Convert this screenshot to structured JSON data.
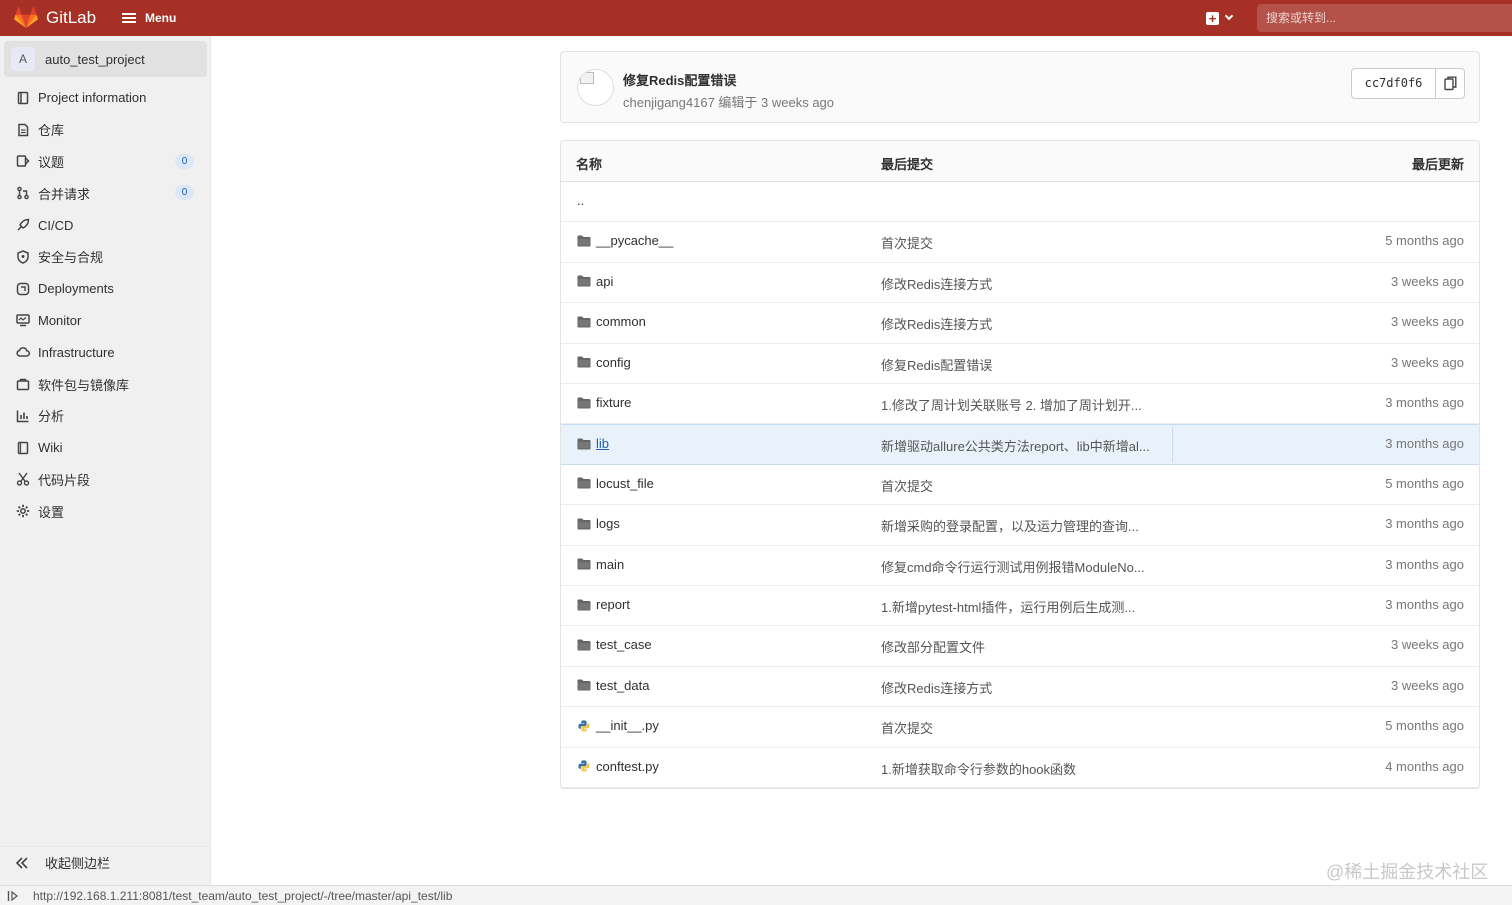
{
  "topbar": {
    "brand": "GitLab",
    "menu_label": "Menu",
    "search_placeholder": "搜索或转到..."
  },
  "sidebar": {
    "project_initial": "A",
    "project_name": "auto_test_project",
    "items": [
      {
        "label": "Project information",
        "icon": "info-book-icon"
      },
      {
        "label": "仓库",
        "icon": "repository-doc-icon"
      },
      {
        "label": "议题",
        "icon": "issues-icon",
        "badge": "0"
      },
      {
        "label": "合并请求",
        "icon": "merge-request-icon",
        "badge": "0"
      },
      {
        "label": "CI/CD",
        "icon": "rocket-icon"
      },
      {
        "label": "安全与合规",
        "icon": "shield-icon"
      },
      {
        "label": "Deployments",
        "icon": "deployments-icon"
      },
      {
        "label": "Monitor",
        "icon": "monitor-icon"
      },
      {
        "label": "Infrastructure",
        "icon": "cloud-icon"
      },
      {
        "label": "软件包与镜像库",
        "icon": "package-icon"
      },
      {
        "label": "分析",
        "icon": "chart-icon"
      },
      {
        "label": "Wiki",
        "icon": "book-icon"
      },
      {
        "label": "代码片段",
        "icon": "scissors-icon"
      },
      {
        "label": "设置",
        "icon": "gear-icon"
      }
    ],
    "collapse_label": "收起侧边栏"
  },
  "commit": {
    "title": "修复Redis配置错误",
    "meta": "chenjigang4167 编辑于 3 weeks ago",
    "sha": "cc7df0f6"
  },
  "tree": {
    "headers": {
      "name": "名称",
      "last_commit": "最后提交",
      "last_update": "最后更新"
    },
    "parent_dir": "..",
    "rows": [
      {
        "name": "__pycache__",
        "type": "folder",
        "commit": "首次提交",
        "date": "5 months ago"
      },
      {
        "name": "api",
        "type": "folder",
        "commit": "修改Redis连接方式",
        "date": "3 weeks ago"
      },
      {
        "name": "common",
        "type": "folder",
        "commit": "修改Redis连接方式",
        "date": "3 weeks ago"
      },
      {
        "name": "config",
        "type": "folder",
        "commit": "修复Redis配置错误",
        "date": "3 weeks ago"
      },
      {
        "name": "fixture",
        "type": "folder",
        "commit": "1.修改了周计划关联账号 2. 增加了周计划开...",
        "date": "3 months ago"
      },
      {
        "name": "lib",
        "type": "folder",
        "commit": "新增驱动allure公共类方法report、lib中新增al...",
        "date": "3 months ago",
        "highlighted": true
      },
      {
        "name": "locust_file",
        "type": "folder",
        "commit": "首次提交",
        "date": "5 months ago"
      },
      {
        "name": "logs",
        "type": "folder",
        "commit": "新增采购的登录配置，以及运力管理的查询...",
        "date": "3 months ago"
      },
      {
        "name": "main",
        "type": "folder",
        "commit": "修复cmd命令行运行测试用例报错ModuleNo...",
        "date": "3 months ago"
      },
      {
        "name": "report",
        "type": "folder",
        "commit": "1.新增pytest-html插件，运行用例后生成测...",
        "date": "3 months ago"
      },
      {
        "name": "test_case",
        "type": "folder",
        "commit": "修改部分配置文件",
        "date": "3 weeks ago"
      },
      {
        "name": "test_data",
        "type": "folder",
        "commit": "修改Redis连接方式",
        "date": "3 weeks ago"
      },
      {
        "name": "__init__.py",
        "type": "python",
        "commit": "首次提交",
        "date": "5 months ago"
      },
      {
        "name": "conftest.py",
        "type": "python",
        "commit": "1.新增获取命令行参数的hook函数",
        "date": "4 months ago"
      }
    ]
  },
  "statusbar": {
    "url": "http://192.168.1.211:8081/test_team/auto_test_project/-/tree/master/api_test/lib"
  },
  "watermark": "@稀土掘金技术社区",
  "colors": {
    "topbar": "#a63025",
    "sidebar": "#f0f0f0",
    "link": "#1f5fad",
    "highlight_row": "#e9f2fb"
  }
}
